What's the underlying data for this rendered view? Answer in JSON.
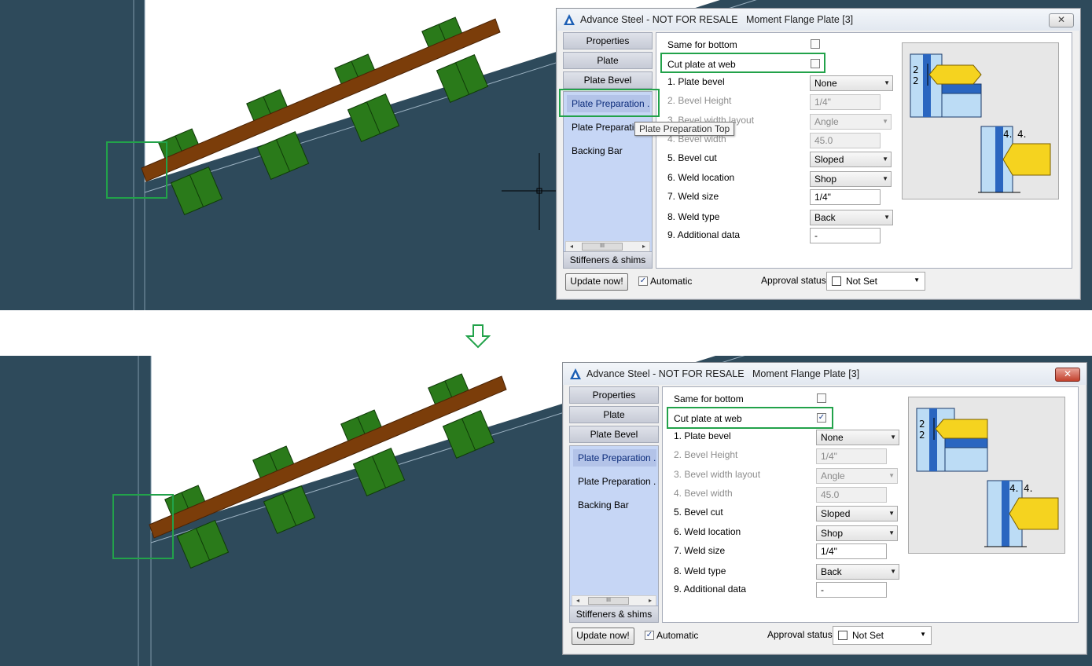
{
  "dialog": {
    "title": "Advance Steel - NOT FOR RESALE   Moment Flange Plate [3]",
    "close_glyph": "✕",
    "nav": {
      "tabs": [
        "Properties",
        "Plate",
        "Plate Bevel"
      ],
      "items": [
        "Plate Preparation ...",
        "Plate Preparation ...",
        "Backing Bar"
      ],
      "bottom_tab": "Stiffeners & shims",
      "scroll_left": "◂",
      "scroll_right": "▸",
      "scroll_thumb": "III"
    },
    "fields": {
      "same_for_bottom": "Same for bottom",
      "cut_plate_at_web": "Cut plate at web",
      "plate_bevel": {
        "label": "1. Plate bevel",
        "value": "None"
      },
      "bevel_height": {
        "label": "2. Bevel Height",
        "value": "1/4\""
      },
      "bevel_width_layout": {
        "label": "3. Bevel width layout",
        "value": "Angle"
      },
      "bevel_width": {
        "label": "4. Bevel width",
        "value": "45.0"
      },
      "bevel_cut": {
        "label": "5. Bevel cut",
        "value": "Sloped"
      },
      "weld_location": {
        "label": "6. Weld location",
        "value": "Shop"
      },
      "weld_size": {
        "label": "7. Weld size",
        "value": "1/4\""
      },
      "weld_type": {
        "label": "8. Weld type",
        "value": "Back"
      },
      "additional_data": {
        "label": "9. Additional data",
        "value": "-"
      }
    },
    "footer": {
      "update_button": "Update now!",
      "automatic_label": "Automatic",
      "approval_label": "Approval status",
      "approval_value": "Not Set"
    },
    "preview_labels": [
      "2",
      "2",
      "4.",
      "4."
    ],
    "tooltip": "Plate Preparation Top",
    "dropdown_glyph": "▼",
    "check_glyph": "✓"
  },
  "state": {
    "before": {
      "cut_plate_at_web_checked": false,
      "close_style": "normal"
    },
    "after": {
      "cut_plate_at_web_checked": true,
      "close_style": "red"
    }
  },
  "colors": {
    "viewport_bg": "#2e4a5b",
    "beam": "#7b3d0a",
    "bolt_green": "#2a7a1a",
    "highlight": "#22a24a",
    "selected_item": "#b3c3e8"
  }
}
